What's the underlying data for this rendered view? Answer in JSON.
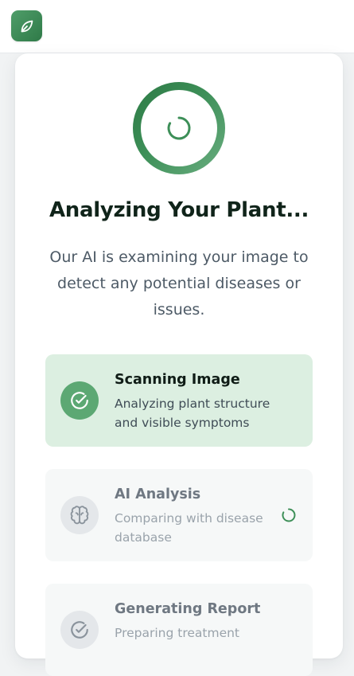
{
  "header": {
    "logo_icon": "leaf-icon",
    "brand_color": "#3d8f58"
  },
  "analysis": {
    "progress_icon": "loading-spinner-icon",
    "title": "Analyzing Your Plant...",
    "subtitle": "Our AI is examining your image to detect any potential diseases or issues."
  },
  "steps": [
    {
      "title": "Scanning Image",
      "description": "Analyzing plant structure and visible symptoms",
      "icon": "check-circle-icon",
      "status": "complete",
      "color": "#5ca873"
    },
    {
      "title": "AI Analysis",
      "description": "Comparing with disease database",
      "icon": "brain-icon",
      "status": "in-progress",
      "status_icon": "loading-spinner-icon"
    },
    {
      "title": "Generating Report",
      "description": "Preparing treatment",
      "icon": "check-circle-icon",
      "status": "pending"
    }
  ]
}
